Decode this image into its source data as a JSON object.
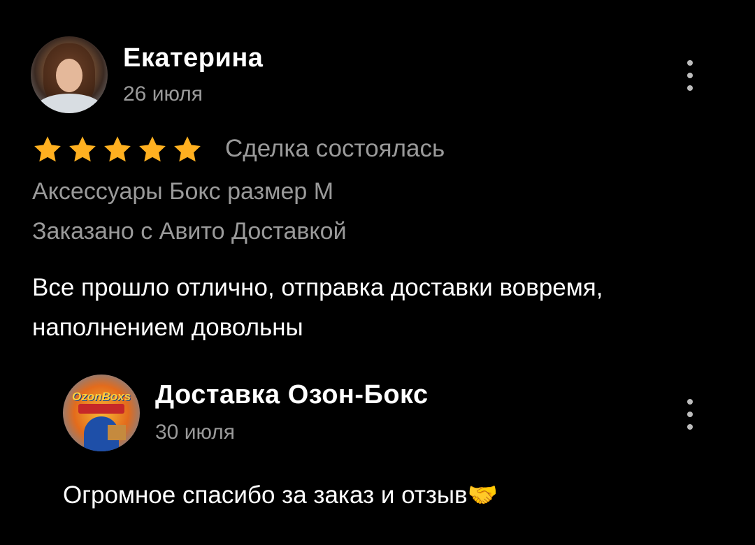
{
  "review": {
    "author": "Екатерина",
    "date": "26 июля",
    "rating": 5,
    "deal_status": "Сделка состоялась",
    "item": "Аксессуары Бокс размер M",
    "delivery": "Заказано с Авито Доставкой",
    "text": "Все прошло отлично, отправка доставки вовремя, наполнением довольны",
    "avatar_icon": "user-photo"
  },
  "reply": {
    "author": "Доставка Озон-Бокс",
    "date": "30 июля",
    "text": "Огромное спасибо за заказ и отзыв🤝",
    "avatar_icon": "shop-logo",
    "avatar_text": "OzonBoxs"
  },
  "colors": {
    "background": "#000000",
    "primary_text": "#ffffff",
    "secondary_text": "#9a9a9a",
    "star": "#ffb020",
    "menu_dots": "#bdbdbd"
  }
}
